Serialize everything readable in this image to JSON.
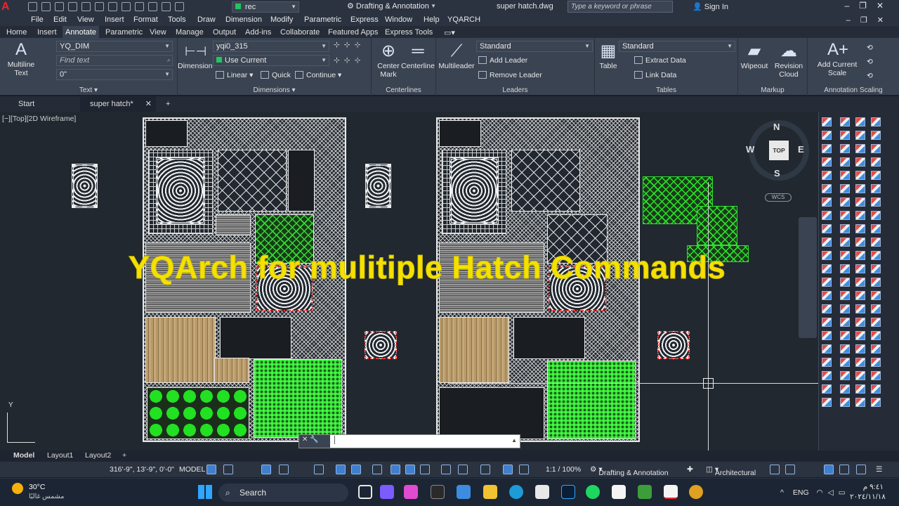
{
  "titlebar": {
    "app_logo": "A",
    "layer_value": "rec",
    "workspace": "Drafting & Annotation",
    "file_name": "super hatch.dwg",
    "search_placeholder": "Type a keyword or phrase",
    "sign_in": "Sign In"
  },
  "menu": [
    "File",
    "Edit",
    "View",
    "Insert",
    "Format",
    "Tools",
    "Draw",
    "Dimension",
    "Modify",
    "Parametric",
    "Express",
    "Window",
    "Help",
    "YQARCH"
  ],
  "ribbon_tabs": [
    "Home",
    "Insert",
    "Annotate",
    "Parametric",
    "View",
    "Manage",
    "Output",
    "Add-ins",
    "Collaborate",
    "Featured Apps",
    "Express Tools"
  ],
  "ribbon_active_tab": "Annotate",
  "ribbon": {
    "text_panel": {
      "title": "Text",
      "multiline_text": "Multiline Text",
      "text_style": "YQ_DIM",
      "find_text_placeholder": "Find text",
      "text_height": "0\""
    },
    "dimensions_panel": {
      "title": "Dimensions",
      "dimension": "Dimension",
      "dim_style": "yqi0_315",
      "dim_layer": "Use Current",
      "linear": "Linear",
      "quick": "Quick",
      "continue": "Continue"
    },
    "centerlines_panel": {
      "title": "Centerlines",
      "center_mark": "Center Mark",
      "centerline": "Centerline"
    },
    "leaders_panel": {
      "title": "Leaders",
      "multileader": "Multileader",
      "leader_style": "Standard",
      "add_leader": "Add Leader",
      "remove_leader": "Remove Leader"
    },
    "tables_panel": {
      "title": "Tables",
      "table": "Table",
      "table_style": "Standard",
      "extract_data": "Extract Data",
      "link_data": "Link Data"
    },
    "markup_panel": {
      "title": "Markup",
      "wipeout": "Wipeout",
      "revision_cloud": "Revision Cloud"
    },
    "annotation_scaling_panel": {
      "title": "Annotation Scaling",
      "add_current_scale": "Add Current Scale"
    }
  },
  "doc_tabs": [
    "Start",
    "super hatch*"
  ],
  "viewport_label": "[−][Top][2D Wireframe]",
  "caption": "YQArch for mulitiple Hatch Commands",
  "viewcube": {
    "n": "N",
    "s": "S",
    "e": "E",
    "w": "W",
    "top": "TOP",
    "wcs": "WCS"
  },
  "ucs": {
    "y": "Y"
  },
  "command_prompt": "│",
  "layout_tabs": [
    "Model",
    "Layout1",
    "Layout2",
    "+"
  ],
  "status": {
    "coords": "316'-9\", 13'-9\", 0'-0\"",
    "space": "MODEL",
    "scale": "1:1 / 100%",
    "workspace": "Drafting & Annotation",
    "units": "Architectural"
  },
  "taskbar": {
    "temperature": "30°C",
    "weather": "مشمس غالبًا",
    "search": "Search",
    "lang": "ENG",
    "time": "٩:٤١ م",
    "date": "٢٠٢٤/١١/١٨"
  },
  "colors": {
    "accent_green": "#22c55e",
    "caption_yellow": "#f5e100",
    "autocad_red": "#e8262b"
  }
}
